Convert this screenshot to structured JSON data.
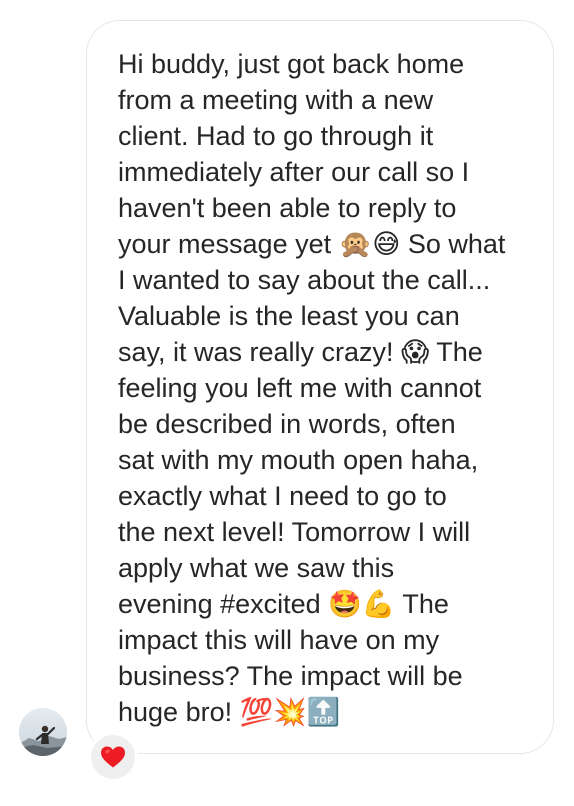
{
  "message": {
    "lines": [
      "Hi buddy, just got back home",
      "from a meeting with a new",
      "client. Had to go through it",
      "immediately after our call so I",
      "haven't been able to reply to",
      "your message yet 🙊😅 So what",
      "I wanted to say about the call...",
      "Valuable is the least you can",
      "say, it was really crazy! 😱 The",
      "feeling you left me with cannot",
      "be described in words, often",
      "sat with my mouth open haha,",
      "exactly what I need to go to",
      "the next level! Tomorrow I will",
      "apply what we saw this",
      "evening #excited 🤩💪 The",
      "impact this will have on my",
      "business? The impact will be",
      "huge bro! 💯💥🔝"
    ]
  },
  "sender": {
    "avatar_icon": "profile-photo"
  },
  "reaction": {
    "emoji_icon": "red-heart-icon",
    "color": "#ed1c24"
  },
  "colors": {
    "bubble_border": "#e4e6eb",
    "text": "#262626",
    "reaction_bg": "#efefef"
  }
}
